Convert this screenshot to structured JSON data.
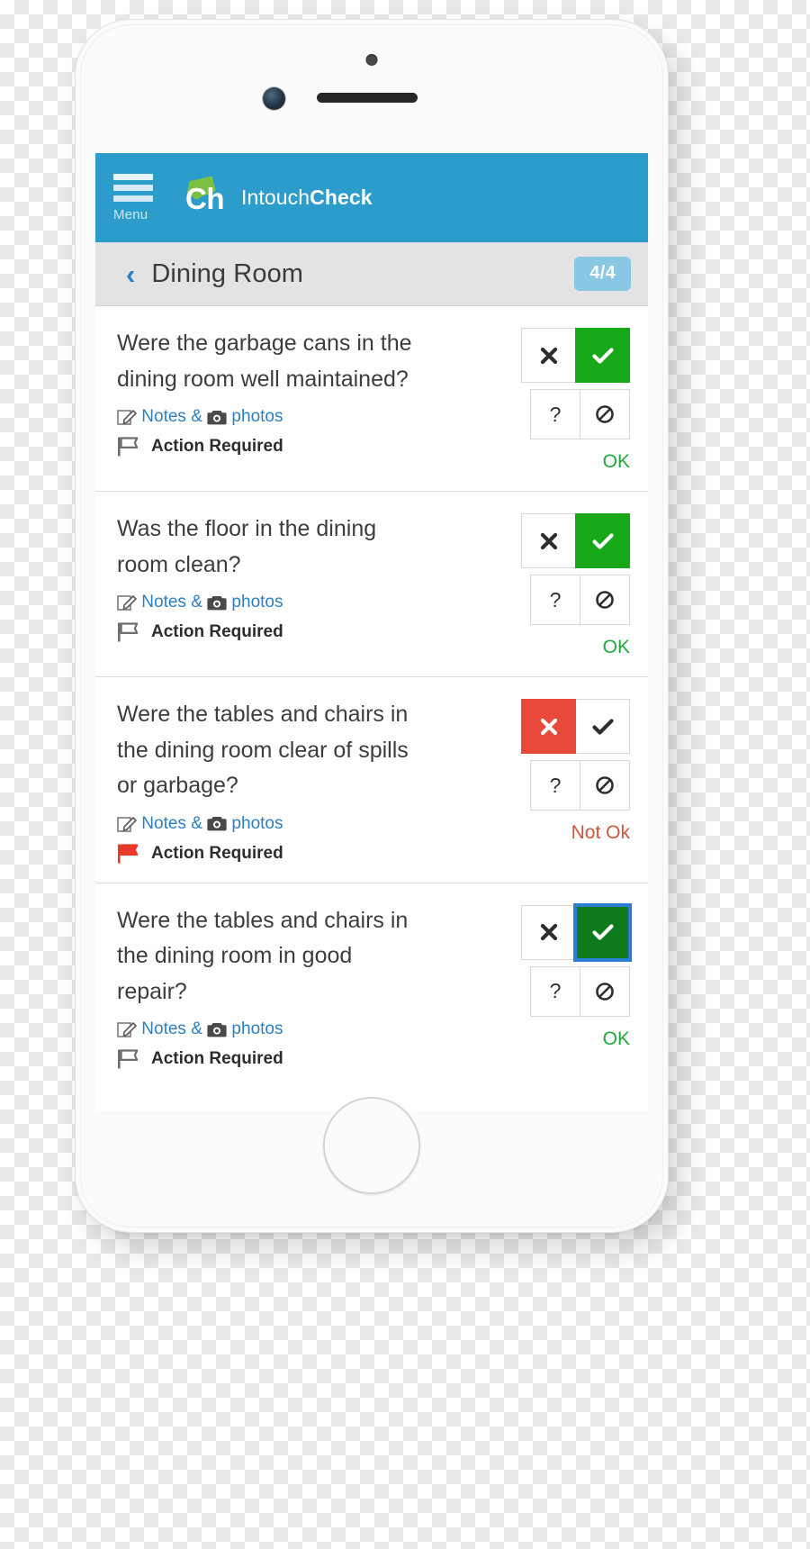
{
  "app": {
    "menu_label": "Menu",
    "logo_text": "Ch",
    "brand_prefix": "Intouch",
    "brand_suffix": "Check",
    "header_color": "#2c9dcb",
    "logo_green": "#7bc043"
  },
  "sub_header": {
    "back_icon": "chevron-left-icon",
    "title": "Dining Room",
    "count_badge": "4/4",
    "badge_color": "#8ac7e2"
  },
  "common": {
    "notes_label_a": "Notes &",
    "notes_label_b": "photos",
    "action_required_label": "Action Required",
    "no_icon": "cross-icon",
    "yes_icon": "check-icon",
    "unknown_icon": "question-mark-icon",
    "na_icon": "not-applicable-icon",
    "note_icon": "note-edit-icon",
    "camera_icon": "camera-icon",
    "flag_icon": "flag-icon"
  },
  "questions": [
    {
      "text": "Were the garbage cans in the dining room well maintained?",
      "selected": "yes",
      "status": "OK",
      "status_color": "#21a73e",
      "flag_color": "#6e6e6e",
      "focused": false
    },
    {
      "text": "Was the floor in the dining room clean?",
      "selected": "yes",
      "status": "OK",
      "status_color": "#21a73e",
      "flag_color": "#6e6e6e",
      "focused": false
    },
    {
      "text": "Were the tables and chairs in the dining room clear of spills or garbage?",
      "selected": "no",
      "status": "Not Ok",
      "status_color": "#d0563f",
      "flag_color": "#e8392a",
      "focused": false
    },
    {
      "text": "Were the tables and chairs in the dining room in good repair?",
      "selected": "yes",
      "status": "OK",
      "status_color": "#21a73e",
      "flag_color": "#6e6e6e",
      "focused": true
    }
  ]
}
